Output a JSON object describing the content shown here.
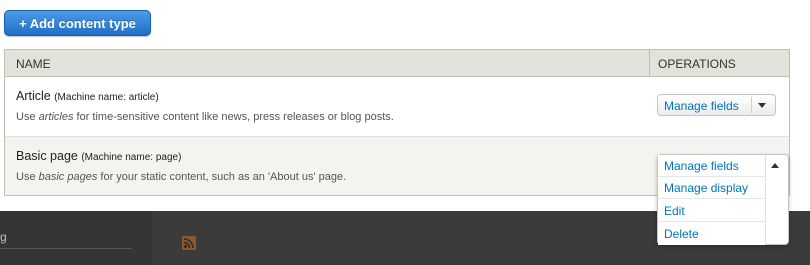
{
  "add_button": {
    "plus": "+",
    "label": "Add content type"
  },
  "table": {
    "headers": {
      "name": "NAME",
      "operations": "OPERATIONS"
    },
    "rows": [
      {
        "title": "Article",
        "machine_name": "(Machine name: article)",
        "desc_before": "Use ",
        "desc_em": "articles",
        "desc_after": " for time-sensitive content like news, press releases or blog posts.",
        "operation": "Manage fields"
      },
      {
        "title": "Basic page",
        "machine_name": "(Machine name: page)",
        "desc_before": "Use ",
        "desc_em": "basic pages",
        "desc_after": " for your static content, such as an 'About us' page.",
        "operations_menu": [
          "Manage fields",
          "Manage display",
          "Edit",
          "Delete"
        ]
      }
    ]
  },
  "footer": {
    "partial_text": "g"
  },
  "icons": {
    "rss": "rss-icon",
    "dropdown_closed": "chevron-down-icon",
    "dropdown_open": "chevron-up-icon"
  },
  "colors": {
    "accent": "#1f6fc7",
    "link": "#0074bd",
    "footer_bg": "#3b3b3b"
  }
}
